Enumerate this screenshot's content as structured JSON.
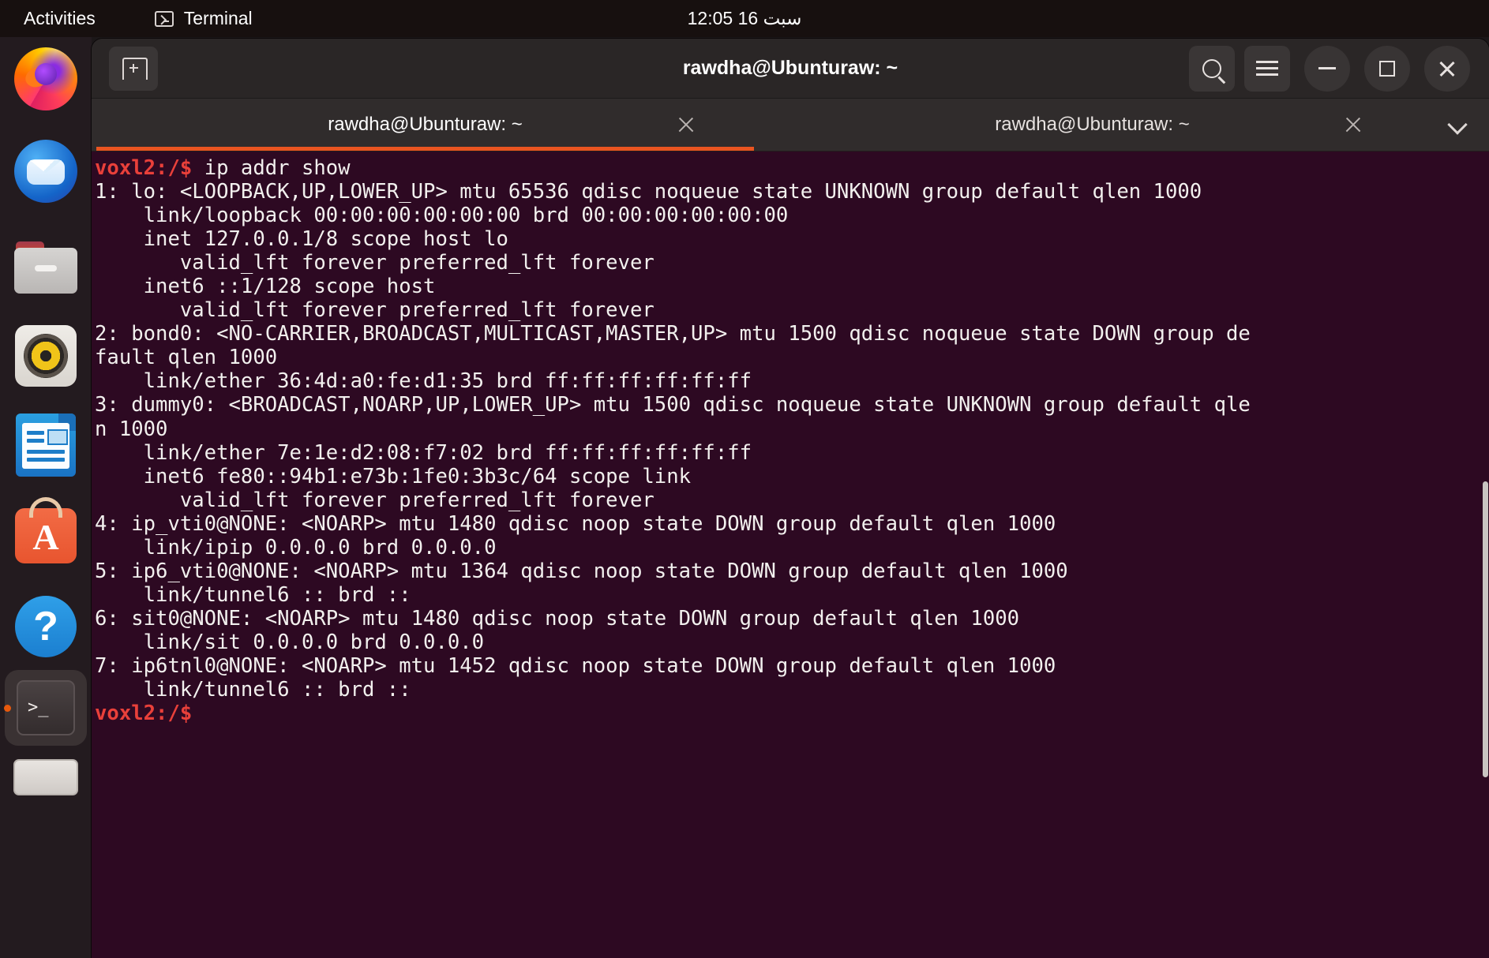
{
  "topbar": {
    "activities": "Activities",
    "app_indicator": "Terminal",
    "app_icon": "terminal-icon",
    "clock": "12:05  16 سبت"
  },
  "dock": {
    "items": [
      {
        "name": "firefox",
        "label": "Firefox",
        "running": true,
        "active": false
      },
      {
        "name": "thunderbird",
        "label": "Thunderbird Mail",
        "running": false,
        "active": false
      },
      {
        "name": "files",
        "label": "Files",
        "running": false,
        "active": false
      },
      {
        "name": "rhythmbox",
        "label": "Rhythmbox",
        "running": false,
        "active": false
      },
      {
        "name": "libreoffice-writer",
        "label": "LibreOffice Writer",
        "running": false,
        "active": false
      },
      {
        "name": "ubuntu-software",
        "label": "Ubuntu Software",
        "running": false,
        "active": false
      },
      {
        "name": "help",
        "label": "Help",
        "running": false,
        "active": false
      },
      {
        "name": "terminal",
        "label": "Terminal",
        "running": true,
        "active": true
      },
      {
        "name": "show-applications",
        "label": "Show Applications",
        "running": false,
        "active": false
      }
    ]
  },
  "window": {
    "title": "rawdha@Ubunturaw: ~",
    "newtab_icon": "tab-new-icon",
    "header_buttons": [
      {
        "name": "search-button",
        "icon": "search-icon"
      },
      {
        "name": "menu-button",
        "icon": "hamburger-icon"
      },
      {
        "name": "minimize-button",
        "icon": "minimize-icon"
      },
      {
        "name": "maximize-button",
        "icon": "maximize-icon"
      },
      {
        "name": "close-button",
        "icon": "close-icon"
      }
    ],
    "accent_color": "#e95420",
    "background_color": "#2d0922"
  },
  "tabs": {
    "items": [
      {
        "label": "rawdha@Ubunturaw: ~",
        "active": true
      },
      {
        "label": "rawdha@Ubunturaw: ~",
        "active": false
      }
    ],
    "close_icon": "close-icon",
    "dropdown_icon": "chevron-down-icon"
  },
  "terminal": {
    "prompt": "voxl2:/$",
    "command": "ip addr show",
    "final_prompt": "voxl2:/$",
    "lines": [
      "1: lo: <LOOPBACK,UP,LOWER_UP> mtu 65536 qdisc noqueue state UNKNOWN group default qlen 1000",
      "    link/loopback 00:00:00:00:00:00 brd 00:00:00:00:00:00",
      "    inet 127.0.0.1/8 scope host lo",
      "       valid_lft forever preferred_lft forever",
      "    inet6 ::1/128 scope host",
      "       valid_lft forever preferred_lft forever",
      "2: bond0: <NO-CARRIER,BROADCAST,MULTICAST,MASTER,UP> mtu 1500 qdisc noqueue state DOWN group de",
      "fault qlen 1000",
      "    link/ether 36:4d:a0:fe:d1:35 brd ff:ff:ff:ff:ff:ff",
      "3: dummy0: <BROADCAST,NOARP,UP,LOWER_UP> mtu 1500 qdisc noqueue state UNKNOWN group default qle",
      "n 1000",
      "    link/ether 7e:1e:d2:08:f7:02 brd ff:ff:ff:ff:ff:ff",
      "    inet6 fe80::94b1:e73b:1fe0:3b3c/64 scope link",
      "       valid_lft forever preferred_lft forever",
      "4: ip_vti0@NONE: <NOARP> mtu 1480 qdisc noop state DOWN group default qlen 1000",
      "    link/ipip 0.0.0.0 brd 0.0.0.0",
      "5: ip6_vti0@NONE: <NOARP> mtu 1364 qdisc noop state DOWN group default qlen 1000",
      "    link/tunnel6 :: brd ::",
      "6: sit0@NONE: <NOARP> mtu 1480 qdisc noop state DOWN group default qlen 1000",
      "    link/sit 0.0.0.0 brd 0.0.0.0",
      "7: ip6tnl0@NONE: <NOARP> mtu 1452 qdisc noop state DOWN group default qlen 1000",
      "    link/tunnel6 :: brd ::"
    ]
  }
}
